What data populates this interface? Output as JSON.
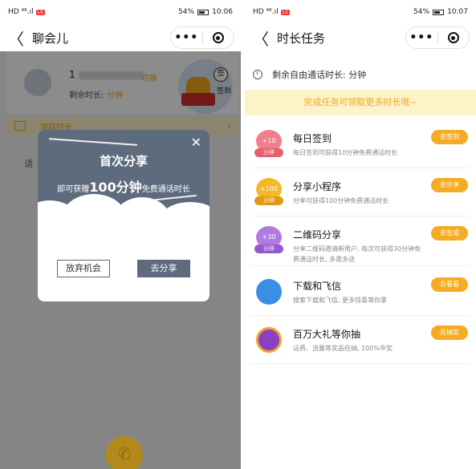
{
  "left": {
    "status": {
      "signal": "HD ⁴⁶.ıl",
      "badge": "LS",
      "battery": "54%",
      "time": "10:06"
    },
    "nav": {
      "back": "〈",
      "title": "聊会儿",
      "more": "•••"
    },
    "profile": {
      "phone_prefix": "1",
      "switch_label": "切换",
      "remain_label": "剩余时长:",
      "remain_value": "分钟",
      "sign_icon": "签",
      "checkin_label": "签到"
    },
    "reward_bar": {
      "label": "领取时长",
      "chevron": "›"
    },
    "hint": "请",
    "modal": {
      "title": "首次分享",
      "desc_before": "即可获赠",
      "desc_big": "100分钟",
      "desc_after": "免费通话时长",
      "close": "✕",
      "quit_button": "放弃机会",
      "share_button": "去分享"
    },
    "call_icon": "✆"
  },
  "right": {
    "status": {
      "signal": "HD ⁴⁶.ıl",
      "badge": "LS",
      "battery": "54%",
      "time": "10:07"
    },
    "nav": {
      "back": "〈",
      "title": "时长任务",
      "more": "•••"
    },
    "remain_text": "剩余自由通话时长: 分钟",
    "banner": "完成任务可领取更多时长哦~",
    "tasks": [
      {
        "badge_num": "+10",
        "badge_tag": "分钟",
        "name": "每日签到",
        "desc": "每日签到可获得10分钟免费通话时长",
        "button": "去签到",
        "color": "#f17f8a"
      },
      {
        "badge_num": "+100",
        "badge_tag": "分钟",
        "name": "分享小程序",
        "desc": "分享可获得100分钟免费通话时长",
        "button": "去分享",
        "color": "#f5b82a"
      },
      {
        "badge_num": "+30",
        "badge_tag": "分钟",
        "name": "二维码分享",
        "desc": "分享二维码邀请新用户, 每次可获得30分钟免费通话时长, 多邀多送",
        "button": "去生成",
        "color": "#b07be0"
      },
      {
        "name": "下载和飞信",
        "desc": "搜索下载和飞信, 更多惊喜等你拿",
        "button": "去看看",
        "color": "#3a8ee6"
      },
      {
        "name": "百万大礼等你抽",
        "desc": "话费、流量等奖品任抽, 100%中奖",
        "button": "去抽奖",
        "color": "#8a3fc4"
      }
    ]
  }
}
